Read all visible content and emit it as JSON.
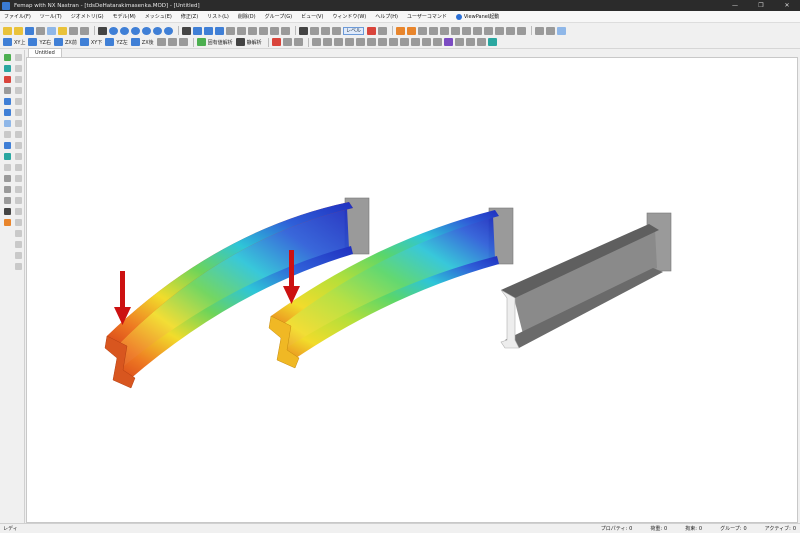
{
  "window": {
    "title": "Femap with NX Nastran - [tdsDeHatarakimasenka.MOD] - [Untitled]",
    "controls": [
      "—",
      "❐",
      "✕"
    ]
  },
  "menu": {
    "items": [
      "ファイル(F)",
      "ツール(T)",
      "ジオメトリ(G)",
      "モデル(M)",
      "メッシュ(E)",
      "修正(Z)",
      "リスト(L)",
      "削除(D)",
      "グループ(G)",
      "ビュー(V)",
      "ウィンドウ(W)",
      "ヘルプ(H)",
      "ユーザーコマンド"
    ],
    "viewpanel": "ViewPanel起動"
  },
  "toolbar2": {
    "xy_top": "XY上",
    "yz_right": "YZ右",
    "zx_front": "ZX前",
    "xy_bottom": "XY下",
    "yz_left": "YZ左",
    "zx_back": "ZX後",
    "eigen": "固有値解析",
    "static": "静解析"
  },
  "toolbar1": {
    "level": "レベル"
  },
  "tab": {
    "label": "Untitled"
  },
  "status": {
    "left": "レディ",
    "fields": [
      {
        "label": "プロパティ:",
        "value": "0"
      },
      {
        "label": "荷重:",
        "value": "0"
      },
      {
        "label": "拘束:",
        "value": "0"
      },
      {
        "label": "グループ:",
        "value": "0"
      },
      {
        "label": "アクティブ:",
        "value": "0"
      }
    ]
  },
  "colors": {
    "title_bar": "#2b2b2b",
    "viewport_bg": "#ffffff",
    "load_arrow": "#cc1111",
    "wall_plate": "#9a9a9a",
    "beam_gray": "#6f6f6f",
    "contour_blue": "#1f2fbf",
    "contour_cyan": "#2ec5d8",
    "contour_green": "#6cd45a",
    "contour_yellow": "#f2dc2b",
    "contour_orange": "#ee7a22",
    "contour_red": "#d9451b"
  }
}
